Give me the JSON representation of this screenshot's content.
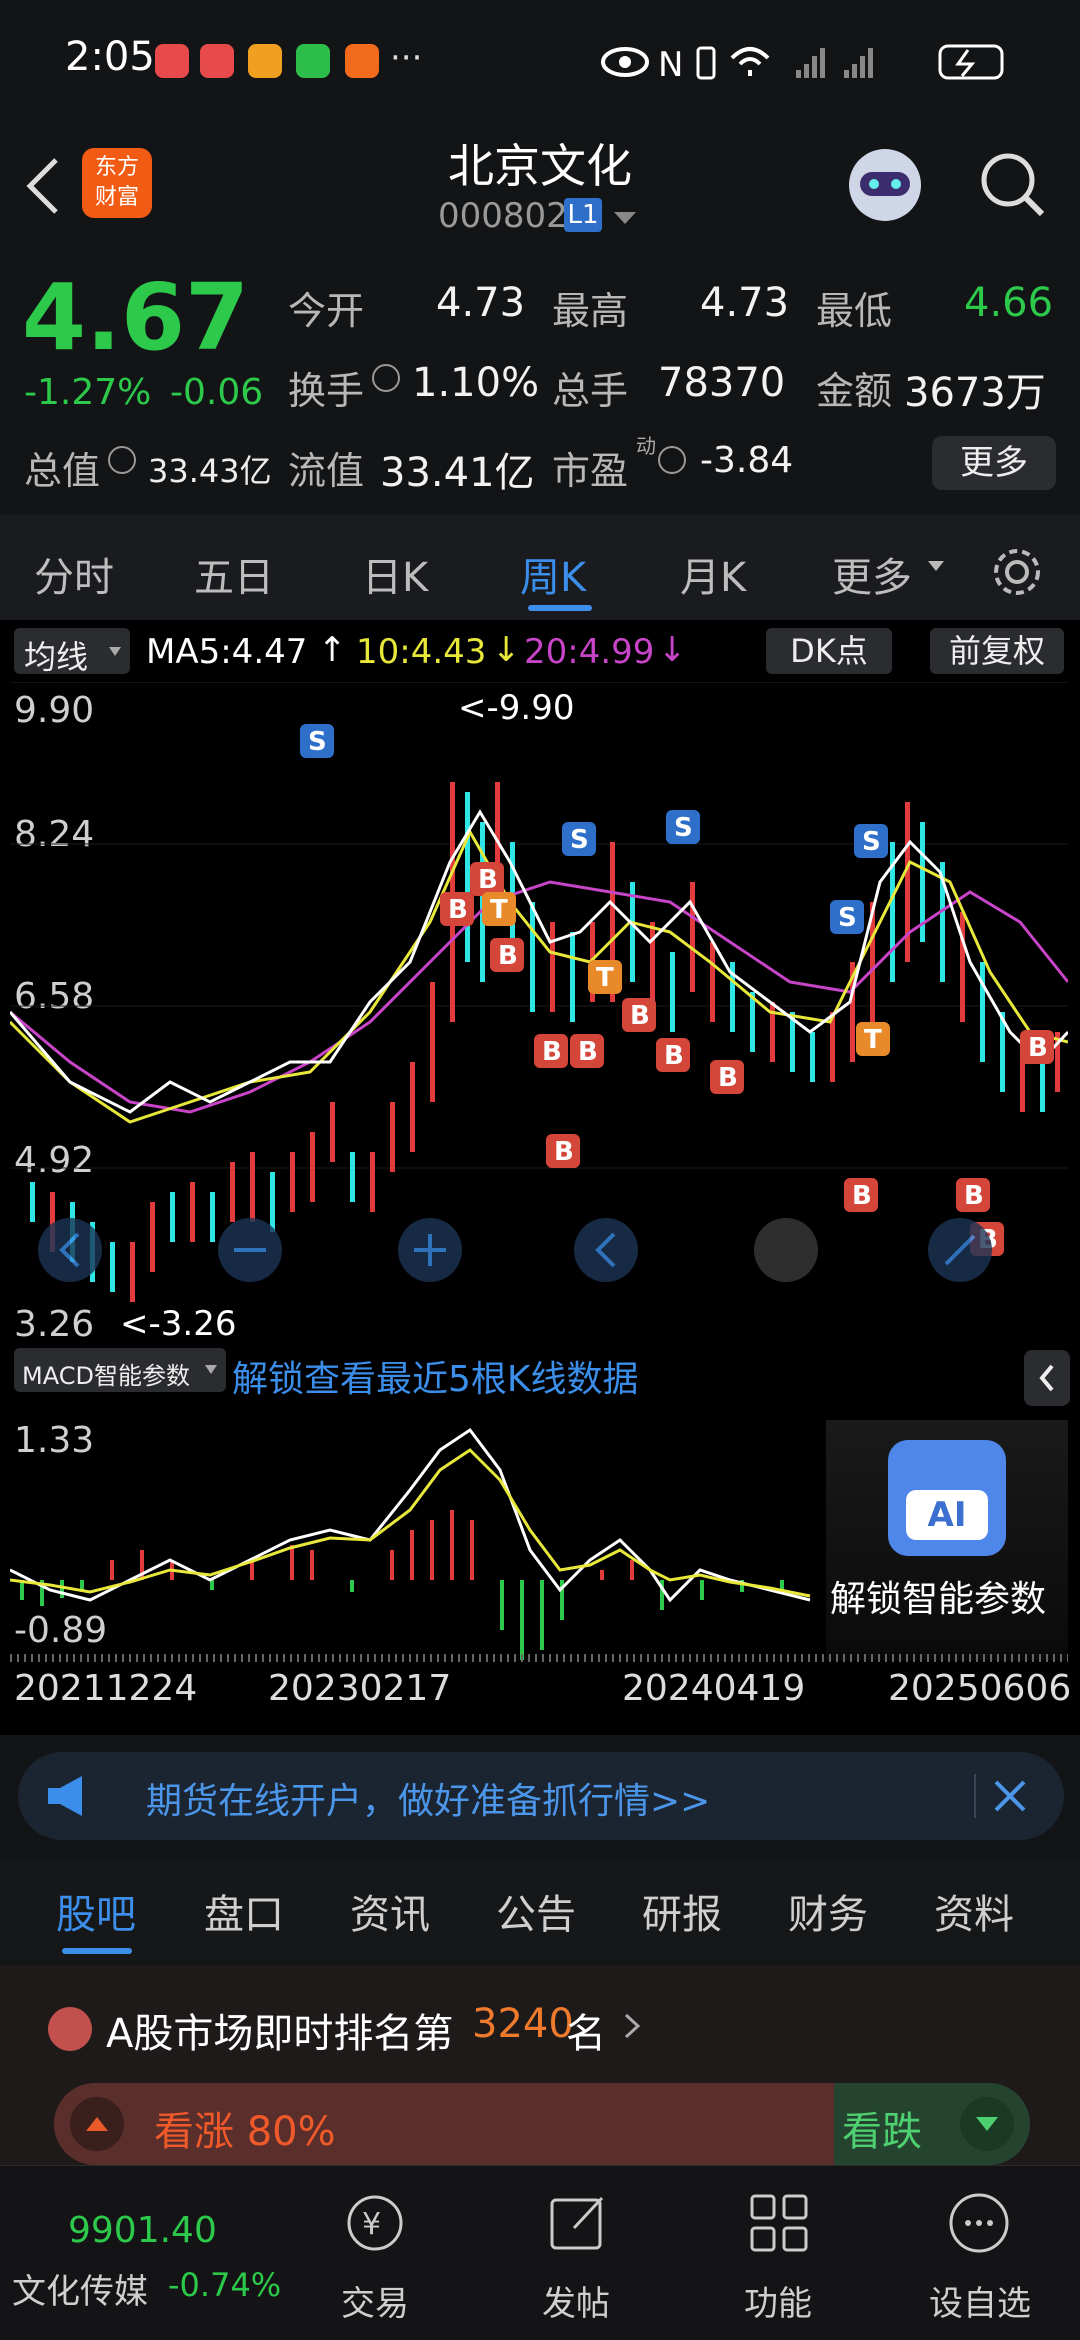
{
  "status_bar": {
    "time": "2:05",
    "dots": "···"
  },
  "header": {
    "back": "<",
    "logo_top": "东方",
    "logo_bottom": "财富",
    "title": "北京文化",
    "code": "000802",
    "level_badge": "L1"
  },
  "quote": {
    "price": "4.67",
    "change_pct": "-1.27%",
    "change_abs": "-0.06",
    "open_label": "今开",
    "open": "4.73",
    "high_label": "最高",
    "high": "4.73",
    "low_label": "最低",
    "low": "4.66",
    "turnover_label": "换手",
    "turnover": "1.10%",
    "volume_label": "总手",
    "volume": "78370",
    "amount_label": "金额",
    "amount": "3673万",
    "mktcap_label": "总值",
    "mktcap": "33.43亿",
    "float_label": "流值",
    "float": "33.41亿",
    "pe_label": "市盈",
    "pe_sup": "动",
    "pe": "-3.84",
    "more": "更多"
  },
  "period_tabs": [
    "分时",
    "五日",
    "日K",
    "周K",
    "月K",
    "更多"
  ],
  "active_tab": "周K",
  "ma_bar": {
    "select": "均线",
    "ma5": "MA5:4.47",
    "ma10": "10:4.43",
    "ma20": "20:4.99",
    "dk": "DK点",
    "fq": "前复权"
  },
  "kline": {
    "y_labels": [
      "9.90",
      "8.24",
      "6.58",
      "4.92",
      "3.26"
    ],
    "max_label": "<-9.90",
    "min_label": "<-3.26"
  },
  "macd": {
    "select": "MACD智能参数",
    "unlock": "解锁查看最近5根K线数据",
    "y_top": "1.33",
    "y_bottom": "-0.89",
    "ai_label": "AI",
    "ai_caption": "解锁智能参数"
  },
  "x_dates": [
    "20211224",
    "20230217",
    "20240419",
    "20250606"
  ],
  "banner": {
    "text": "期货在线开户，做好准备抓行情>>"
  },
  "sub_tabs": [
    "股吧",
    "盘口",
    "资讯",
    "公告",
    "研报",
    "财务",
    "资料"
  ],
  "rank": {
    "prefix": "A股市场即时排名第",
    "number": "3240",
    "suffix": "名",
    "bull": "看涨 80%",
    "bear": "看跌"
  },
  "bottom": {
    "index_value": "9901.40",
    "index_name": "文化传媒",
    "index_change": "-0.74%",
    "nav": [
      "交易",
      "发帖",
      "功能",
      "设自选"
    ]
  },
  "colors": {
    "up": "#e23b3b",
    "down": "#2cc94b",
    "accent": "#3b8eea",
    "ma10": "#e8e83a",
    "ma20": "#c844c8"
  }
}
